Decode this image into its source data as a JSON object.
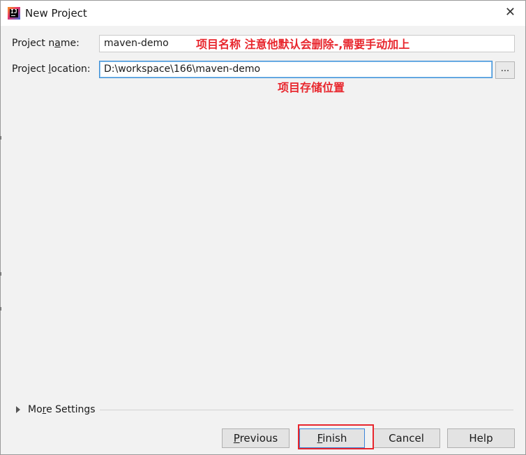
{
  "window": {
    "title": "New Project",
    "app_icon_glyph": "IJ"
  },
  "form": {
    "name_label_pre": "Project n",
    "name_label_mn": "a",
    "name_label_post": "me:",
    "name_value": "maven-demo",
    "location_label_pre": "Project ",
    "location_label_mn": "l",
    "location_label_post": "ocation:",
    "location_value": "D:\\workspace\\166\\maven-demo",
    "browse_label": "..."
  },
  "annotations": {
    "name_note": "项目名称  注意他默认会删除-,需要手动加上",
    "location_note": "项目存储位置",
    "color": "#e8262d"
  },
  "more_settings": {
    "pre": "Mo",
    "mn": "r",
    "post": "e Settings"
  },
  "buttons": {
    "previous_mn": "P",
    "previous_rest": "revious",
    "finish_mn": "F",
    "finish_rest": "inish",
    "cancel": "Cancel",
    "help": "Help"
  }
}
